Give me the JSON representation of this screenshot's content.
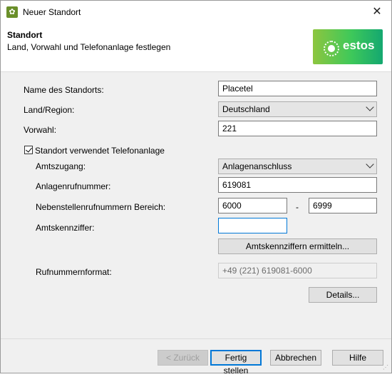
{
  "window": {
    "title": "Neuer Standort"
  },
  "header": {
    "title": "Standort",
    "subtitle": "Land, Vorwahl und Telefonanlage festlegen",
    "logo_text": "estos"
  },
  "form": {
    "name_label": "Name des Standorts:",
    "name_value": "Placetel",
    "country_label": "Land/Region:",
    "country_value": "Deutschland",
    "areacode_label": "Vorwahl:",
    "areacode_value": "221",
    "pbx_checkbox_label": "Standort verwendet Telefonanlage",
    "pbx_checked": true,
    "trunk_label": "Amtszugang:",
    "trunk_value": "Anlagenanschluss",
    "pbx_number_label": "Anlagenrufnummer:",
    "pbx_number_value": "619081",
    "ext_range_label": "Nebenstellenrufnummern Bereich:",
    "ext_range_from": "6000",
    "ext_range_sep": "-",
    "ext_range_to": "6999",
    "access_code_label": "Amtskennziffer:",
    "access_code_value": "",
    "detect_button": "Amtskennziffern ermitteln...",
    "format_label": "Rufnummernformat:",
    "format_value": "+49 (221) 619081-6000",
    "details_button": "Details..."
  },
  "footer": {
    "back": "< Zurück",
    "finish": "Fertig stellen",
    "cancel": "Abbrechen",
    "help": "Hilfe"
  }
}
